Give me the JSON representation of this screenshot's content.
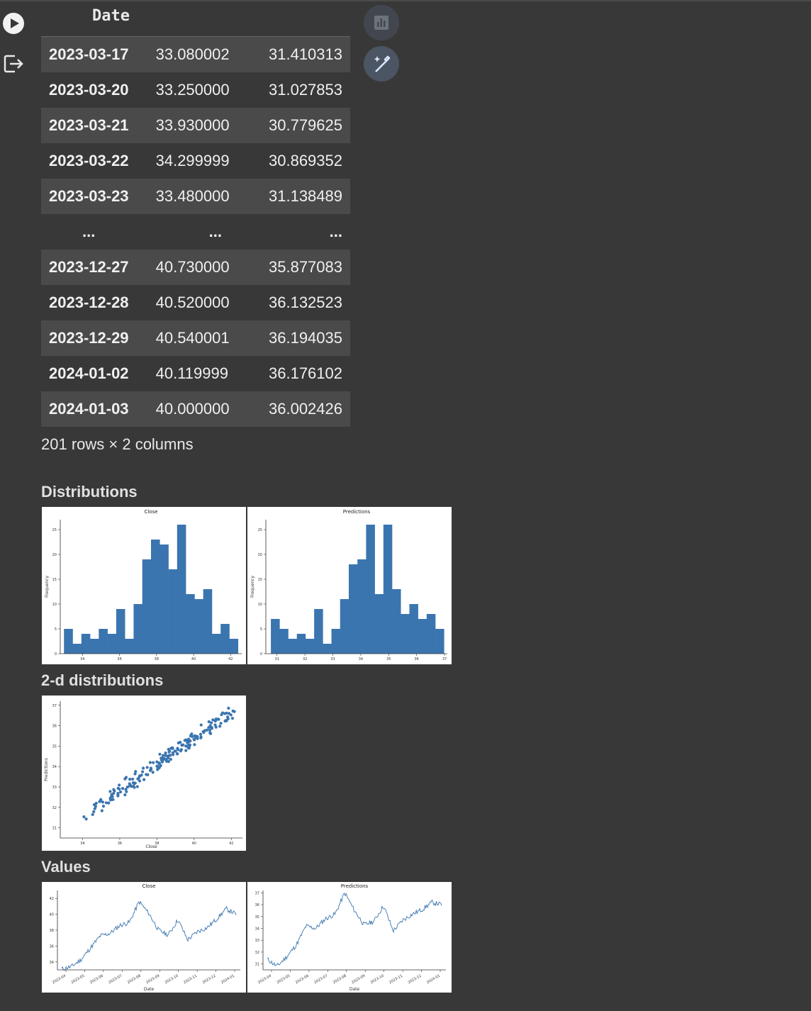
{
  "table": {
    "index_name": "Date",
    "rows": [
      {
        "date": "2023-03-17",
        "close": "33.080002",
        "pred": "31.410313"
      },
      {
        "date": "2023-03-20",
        "close": "33.250000",
        "pred": "31.027853"
      },
      {
        "date": "2023-03-21",
        "close": "33.930000",
        "pred": "30.779625"
      },
      {
        "date": "2023-03-22",
        "close": "34.299999",
        "pred": "30.869352"
      },
      {
        "date": "2023-03-23",
        "close": "33.480000",
        "pred": "31.138489"
      },
      {
        "date": "...",
        "close": "...",
        "pred": "..."
      },
      {
        "date": "2023-12-27",
        "close": "40.730000",
        "pred": "35.877083"
      },
      {
        "date": "2023-12-28",
        "close": "40.520000",
        "pred": "36.132523"
      },
      {
        "date": "2023-12-29",
        "close": "40.540001",
        "pred": "36.194035"
      },
      {
        "date": "2024-01-02",
        "close": "40.119999",
        "pred": "36.176102"
      },
      {
        "date": "2024-01-03",
        "close": "40.000000",
        "pred": "36.002426"
      }
    ],
    "footer": "201 rows × 2 columns"
  },
  "sections": {
    "distributions": "Distributions",
    "two_d": "2-d distributions",
    "values": "Values"
  },
  "colors": {
    "accent": "#3b75af",
    "background": "#383838",
    "row_shade": "#4a4a4a"
  },
  "icons": [
    "play-icon",
    "output-icon",
    "bar-chart-icon",
    "magic-wand-icon"
  ],
  "chart_data": [
    {
      "type": "bar",
      "title": "Close",
      "ylabel": "Frequency",
      "bins_start": 33.0,
      "bin_width": 0.47,
      "values": [
        5,
        2,
        4,
        3,
        5,
        4,
        9,
        3,
        10,
        19,
        23,
        22,
        17,
        26,
        12,
        11,
        13,
        4,
        6,
        3
      ],
      "xlim": [
        32.8,
        42.6
      ],
      "ylim": [
        0,
        27
      ],
      "xticks": [
        34,
        36,
        38,
        40,
        42
      ],
      "yticks": [
        0,
        5,
        10,
        15,
        20,
        25
      ]
    },
    {
      "type": "bar",
      "title": "Predictions",
      "ylabel": "Frequency",
      "bins_start": 30.78,
      "bin_width": 0.31,
      "values": [
        7,
        5,
        3,
        4,
        3,
        9,
        2,
        5,
        11,
        18,
        19,
        26,
        12,
        26,
        13,
        8,
        10,
        7,
        8,
        5
      ],
      "xlim": [
        30.6,
        37.1
      ],
      "ylim": [
        0,
        27
      ],
      "xticks": [
        31,
        32,
        33,
        34,
        35,
        36,
        37
      ],
      "yticks": [
        0,
        5,
        10,
        15,
        20,
        25
      ]
    },
    {
      "type": "scatter",
      "xlabel": "Close",
      "ylabel": "Predictions",
      "xlim": [
        32.8,
        42.6
      ],
      "ylim": [
        30.5,
        37.2
      ],
      "xticks": [
        34,
        36,
        38,
        40,
        42
      ],
      "yticks": [
        31,
        32,
        33,
        34,
        35,
        36,
        37
      ],
      "trend": {
        "x0": 33.0,
        "y0": 30.9,
        "x1": 42.3,
        "y1": 36.9,
        "spread": 0.45
      },
      "count": 201
    },
    {
      "type": "line",
      "title": "Close",
      "xlabel": "Date",
      "x": [
        "2023-04",
        "2023-05",
        "2023-06",
        "2023-07",
        "2023-08",
        "2023-09",
        "2023-10",
        "2023-11",
        "2023-12",
        "2024-01"
      ],
      "anchors": [
        33.1,
        33.4,
        34.3,
        35.8,
        37.3,
        37.6,
        38.6,
        39.0,
        41.6,
        40.1,
        38.0,
        37.4,
        39.3,
        36.8,
        37.8,
        38.3,
        39.4,
        40.7,
        40.0
      ],
      "ylim": [
        33,
        43
      ],
      "yticks": [
        34,
        36,
        38,
        40,
        42
      ]
    },
    {
      "type": "line",
      "title": "Predictions",
      "xlabel": "Date",
      "x": [
        "2023-04",
        "2023-05",
        "2023-06",
        "2023-07",
        "2023-08",
        "2023-09",
        "2023-10",
        "2023-11",
        "2023-12",
        "2024-01"
      ],
      "anchors": [
        31.4,
        30.8,
        31.6,
        32.6,
        34.2,
        34.0,
        34.8,
        35.2,
        37.0,
        35.5,
        34.3,
        34.6,
        35.9,
        33.8,
        34.7,
        35.2,
        35.6,
        36.2,
        36.0
      ],
      "ylim": [
        30.5,
        37.2
      ],
      "yticks": [
        31,
        32,
        33,
        34,
        35,
        36,
        37
      ]
    }
  ]
}
